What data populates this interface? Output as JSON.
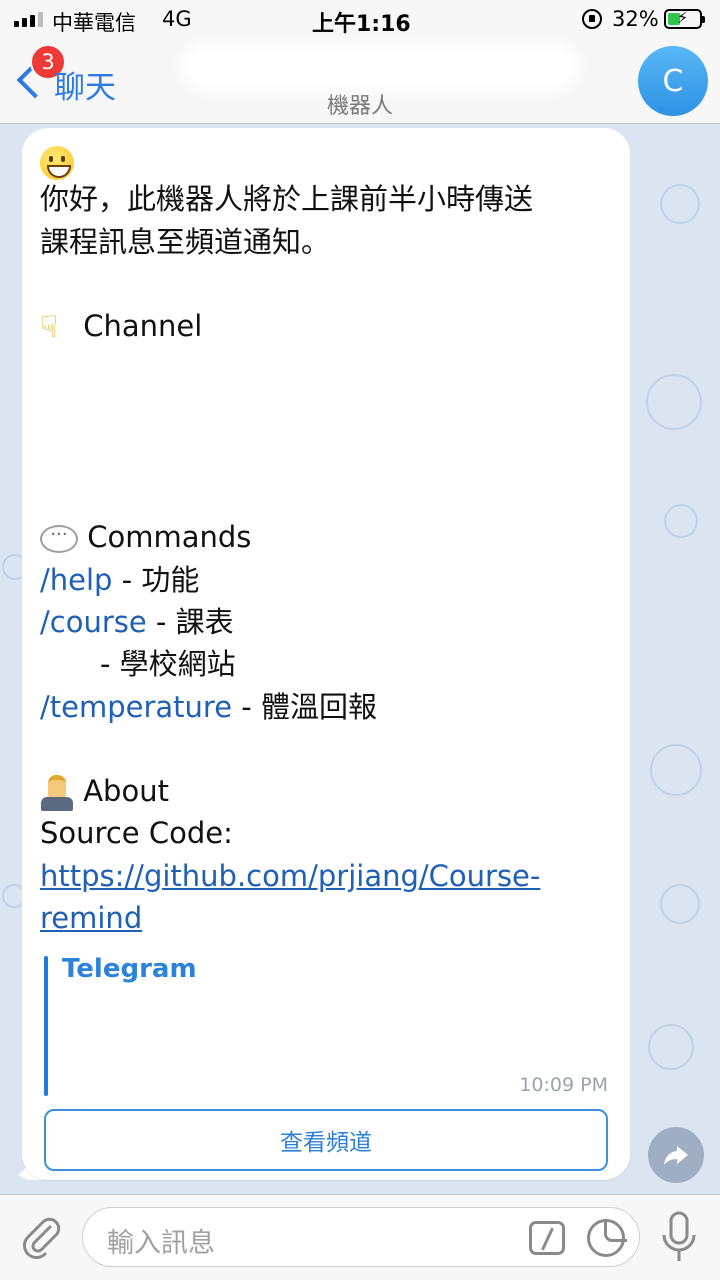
{
  "status_bar": {
    "carrier": "中華電信",
    "network": "4G",
    "time": "上午1:16",
    "battery": "32%"
  },
  "nav": {
    "back_badge": "3",
    "back_label": "聊天",
    "subtitle": "機器人",
    "avatar_letter": "C"
  },
  "message": {
    "greeting_line1": "你好，此機器人將於上課前半小時傳送",
    "greeting_line2": "課程訊息至頻道通知。",
    "channel_heading": "Channel",
    "commands_heading": "Commands",
    "commands": [
      {
        "cmd": "/help",
        "desc": " - 功能"
      },
      {
        "cmd": "/course",
        "desc": " - 課表"
      },
      {
        "cmd": "",
        "desc": " - 學校網站"
      },
      {
        "cmd": "/temperature",
        "desc": " - 體溫回報"
      }
    ],
    "about_heading": "About",
    "source_label": "Source Code:",
    "source_link_line1": "https://github.com/prjiang/Course-",
    "source_link_line2": "remind",
    "preview_title": "Telegram",
    "time": "10:09 PM",
    "view_channel_button": "查看頻道"
  },
  "input": {
    "placeholder": "輸入訊息"
  },
  "colors": {
    "accent": "#2c7be5",
    "link": "#1f5fb5",
    "badge": "#ee3a36",
    "chat_bg": "#dbe5f1"
  }
}
